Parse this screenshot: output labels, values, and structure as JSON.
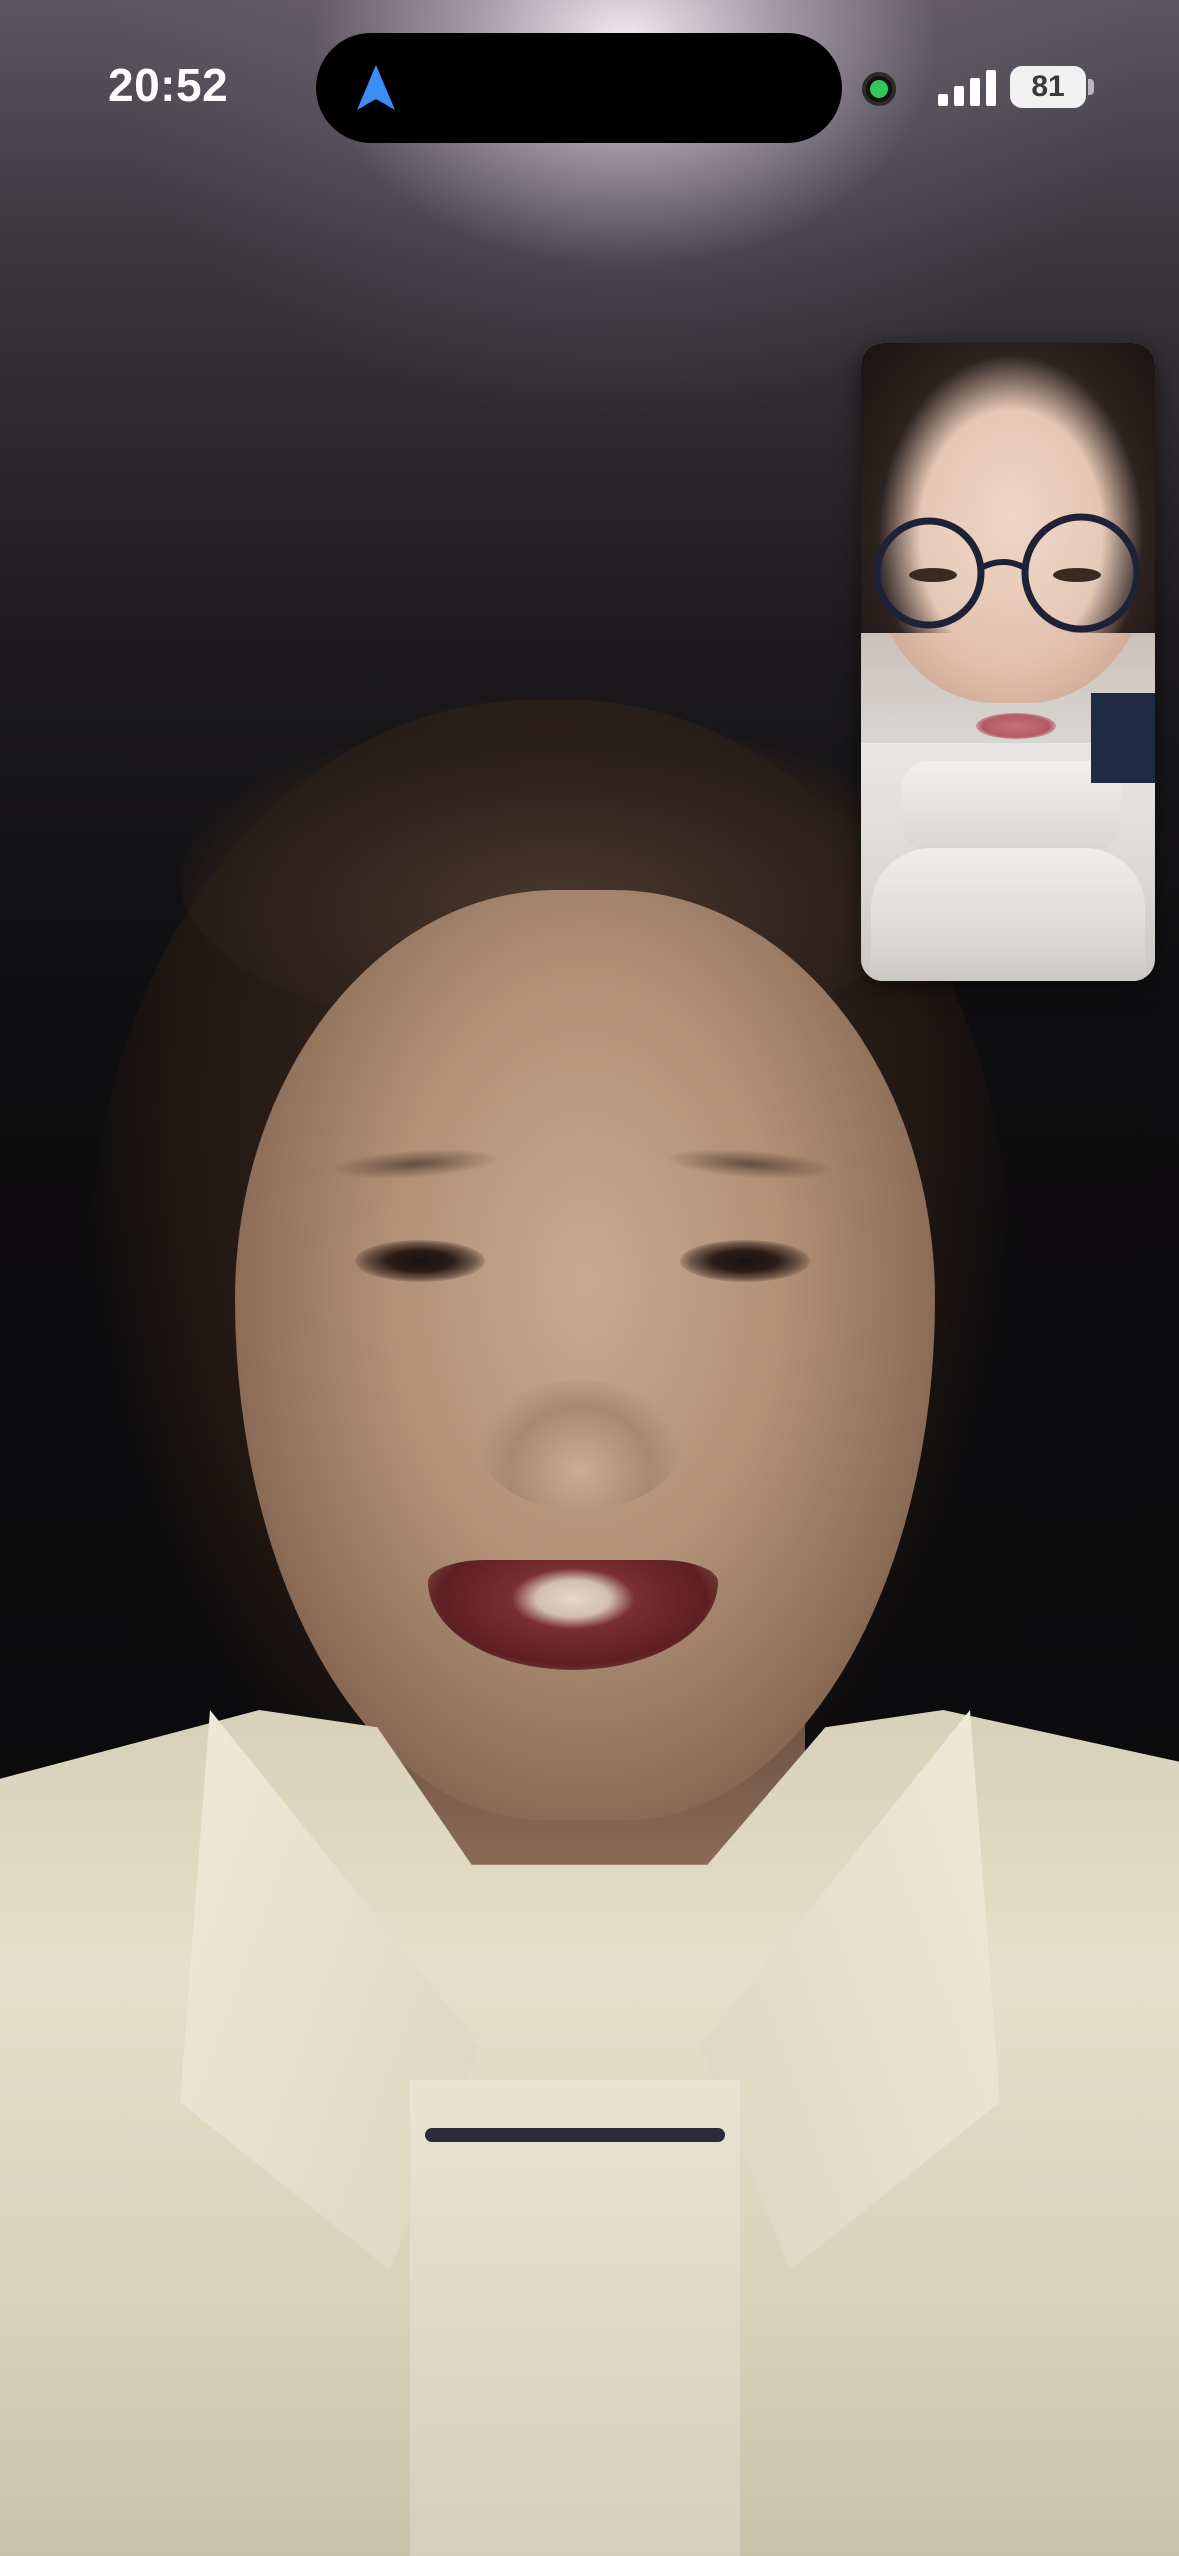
{
  "status_bar": {
    "time": "20:52",
    "battery_level": "81",
    "icons": [
      "navigation-arrow-icon",
      "camera-in-use-indicator",
      "cellular-signal-icon",
      "battery-icon"
    ],
    "colors": {
      "camera_indicator": "#34c759",
      "navigation_arrow": "#3a8ef6"
    }
  },
  "call": {
    "remote_video": "remote-participant-video",
    "self_view": "self-view-video"
  }
}
